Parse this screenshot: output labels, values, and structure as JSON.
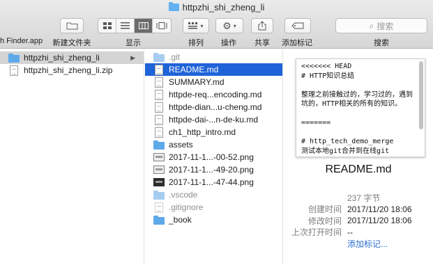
{
  "window": {
    "title": "httpzhi_shi_zheng_li"
  },
  "toolbar": {
    "left_label": "h Finder.app",
    "new_folder_label": "新建文件夹",
    "view_label": "显示",
    "sort_label": "排列",
    "action_label": "操作",
    "share_label": "共享",
    "tag_label": "添加标记",
    "search_label": "搜索",
    "search_placeholder": "搜索"
  },
  "column1": {
    "items": [
      {
        "name": "httpzhi_shi_zheng_li",
        "kind": "folder"
      },
      {
        "name": "httpzhi_shi_zheng_li.zip",
        "kind": "doc"
      }
    ]
  },
  "column2": {
    "items": [
      {
        "name": ".git",
        "kind": "folder"
      },
      {
        "name": "README.md",
        "kind": "doc"
      },
      {
        "name": "SUMMARY.md",
        "kind": "doc"
      },
      {
        "name": "httpde-req...encoding.md",
        "kind": "doc"
      },
      {
        "name": "httpde-dian...u-cheng.md",
        "kind": "doc"
      },
      {
        "name": "httpde-dai-...n-de-ku.md",
        "kind": "doc"
      },
      {
        "name": "ch1_http_intro.md",
        "kind": "doc"
      },
      {
        "name": "assets",
        "kind": "folder"
      },
      {
        "name": "2017-11-1...-00-52.png",
        "kind": "img"
      },
      {
        "name": "2017-11-1...-49-20.png",
        "kind": "img"
      },
      {
        "name": "2017-11-1...-47-44.png",
        "kind": "img"
      },
      {
        "name": ".vscode",
        "kind": "folder"
      },
      {
        "name": ".gitignore",
        "kind": "doc"
      },
      {
        "name": "_book",
        "kind": "folder"
      }
    ]
  },
  "preview": {
    "text": "<<<<<<< HEAD\n# HTTP知识总结\n\n整理之前接触过的，学习过的，遇到坑的，HTTP相关的所有的知识。\n\n=======\n\n# http_tech_demo_merge\n测试本地git合并到在线git",
    "file_name": "README.md",
    "size": "237 字节",
    "created_label": "创建时间",
    "created": "2017/11/20 18:06",
    "modified_label": "修改时间",
    "modified": "2017/11/20 18:06",
    "opened_label": "上次打开时间",
    "opened": "--",
    "add_tags": "添加标记..."
  }
}
